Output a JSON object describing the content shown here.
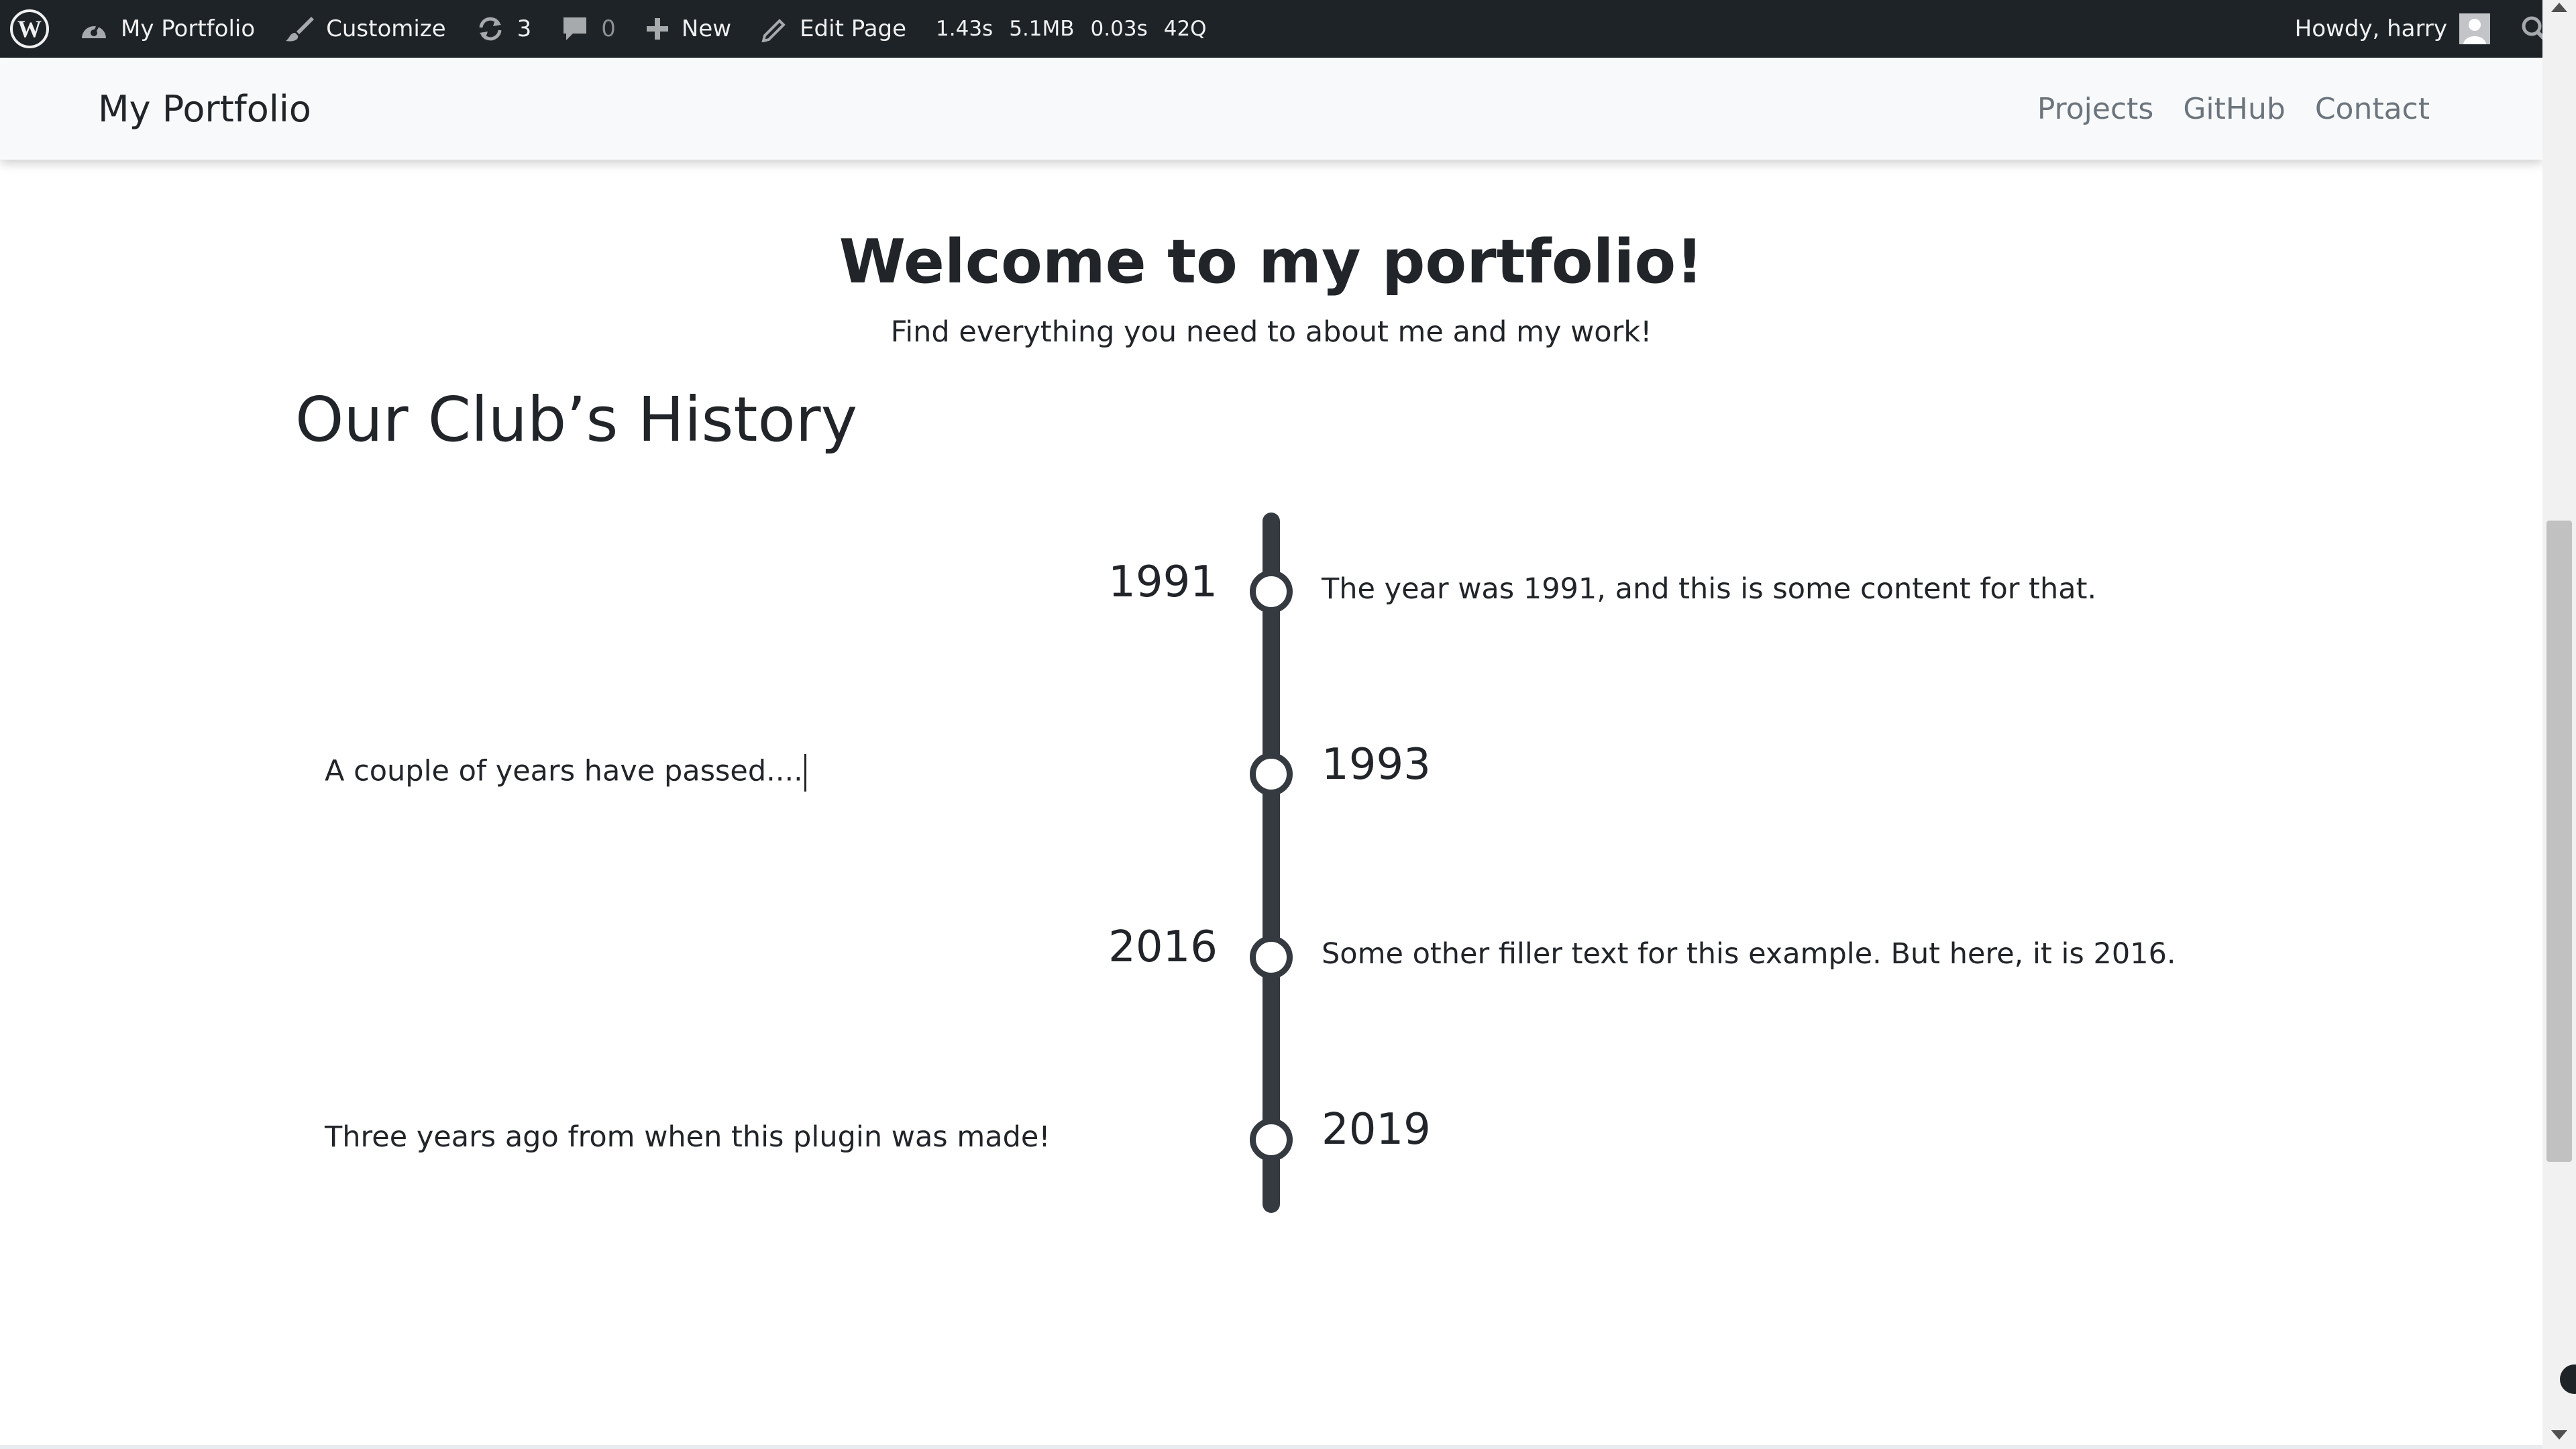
{
  "admin_bar": {
    "site_name": "My Portfolio",
    "customize": "Customize",
    "updates_count": "3",
    "comments_count": "0",
    "new_label": "New",
    "edit_page": "Edit Page",
    "query_monitor": [
      "1.43s",
      "5.1MB",
      "0.03s",
      "42Q"
    ],
    "howdy": "Howdy, harry"
  },
  "header": {
    "brand": "My Portfolio",
    "nav": [
      "Projects",
      "GitHub",
      "Contact"
    ]
  },
  "hero": {
    "title": "Welcome to my portfolio!",
    "subtitle": "Find everything you need to about me and my work!"
  },
  "section_title": "Our Club’s History",
  "timeline": [
    {
      "year": "1991",
      "year_side": "left",
      "text": "The year was 1991, and this is some content for that."
    },
    {
      "year": "1993",
      "year_side": "right",
      "text": "A couple of years have passed...."
    },
    {
      "year": "2016",
      "year_side": "left",
      "text": "Some other filler text for this example. But here, it is 2016."
    },
    {
      "year": "2019",
      "year_side": "right",
      "text": "Three years ago from when this plugin was made!"
    }
  ],
  "colors": {
    "admin_bar_bg": "#1d2327",
    "header_bg": "#f8f9fa",
    "timeline": "#343a40",
    "nav_link": "#6c757d"
  }
}
